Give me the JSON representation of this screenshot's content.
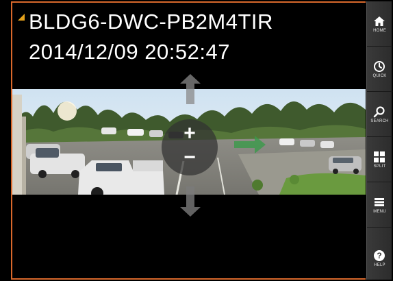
{
  "viewer": {
    "camera_name": "BLDG6-DWC-PB2M4TIR",
    "timestamp": "2014/12/09 20:52:47"
  },
  "controls": {
    "zoom_in_label": "+",
    "zoom_out_label": "−"
  },
  "sidebar": {
    "items": [
      {
        "label": "HOME",
        "icon": "home-icon"
      },
      {
        "label": "QUICK",
        "icon": "clock-icon"
      },
      {
        "label": "SEARCH",
        "icon": "search-icon"
      },
      {
        "label": "SPLIT",
        "icon": "grid-icon"
      },
      {
        "label": "MENU",
        "icon": "list-icon"
      },
      {
        "label": "HELP",
        "icon": "help-icon"
      }
    ]
  },
  "colors": {
    "border_accent": "#d9682b",
    "title_marker": "#e5a21c",
    "pan_right_arrow": "#3a9a4a",
    "sidebar_bg": "#333333"
  }
}
